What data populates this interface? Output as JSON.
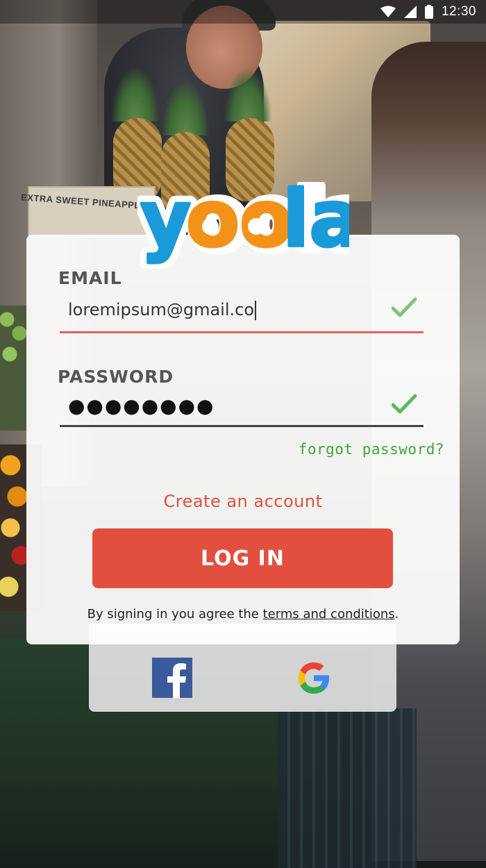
{
  "status_bar": {
    "time": "12:30",
    "icons": [
      "wifi-icon",
      "cell-signal-icon",
      "battery-icon"
    ]
  },
  "background": {
    "crate_text": "EXTRA SWEET PINEAPPLE"
  },
  "logo": {
    "text": "yoola",
    "colors": {
      "blue": "#1a9ad8",
      "orange": "#f39219",
      "outline": "#ffffff"
    }
  },
  "form": {
    "email": {
      "label": "EMAIL",
      "value": "loremipsum@gmail.co",
      "valid": true,
      "underline_color": "#e8604f"
    },
    "password": {
      "label": "PASSWORD",
      "masked_value": "●●●●●●●●",
      "valid": true,
      "underline_color": "#444444"
    },
    "forgot_password": "forgot password?",
    "create_account": "Create an account",
    "login_button": "LOG IN",
    "terms_prefix": "By signing in you agree the ",
    "terms_link": "terms and conditions",
    "terms_suffix": "."
  },
  "social": {
    "facebook_icon": "facebook-icon",
    "google_icon": "google-icon"
  },
  "colors": {
    "accent": "#e24f3f",
    "success": "#3aa83a",
    "check": "#5cb85c"
  }
}
